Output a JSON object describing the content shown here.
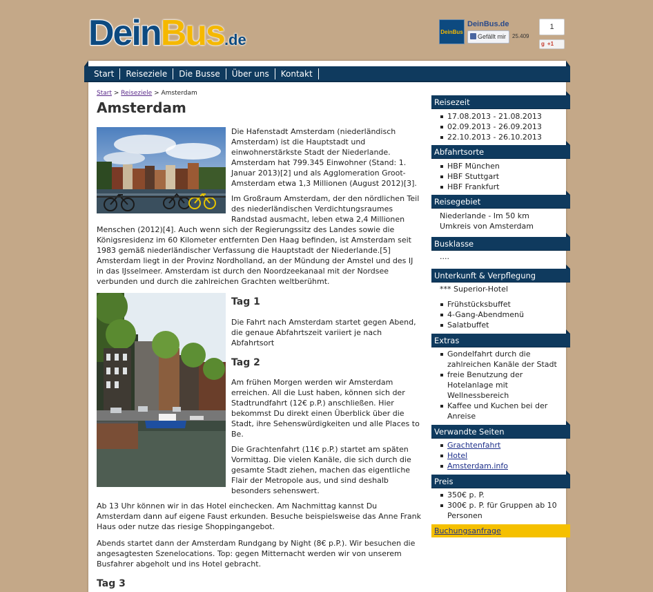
{
  "header": {
    "logo_part1": "Dein",
    "logo_part2": "Bus",
    "logo_part3": ".de",
    "fb_thumb_text": "DeinBus",
    "fb_page_name": "DeinBus.de",
    "fb_like_label": "Gefällt mir",
    "fb_like_count": "25.409",
    "gplus_count": "1",
    "gplus_label": "+1"
  },
  "nav": {
    "items": [
      "Start",
      "Reiseziele",
      "Die Busse",
      "Über uns",
      "Kontakt"
    ]
  },
  "breadcrumb": {
    "start": "Start",
    "sep": ">",
    "reiseziele": "Reiseziele",
    "current": "Amsterdam"
  },
  "page_title": "Amsterdam",
  "content": {
    "intro_p1": "Die Hafenstadt Amsterdam (niederländisch Amsterdam) ist die Hauptstadt und einwohnerstärkste Stadt der Niederlande. Amsterdam hat 799.345 Einwohner (Stand: 1. Januar 2013)[2] und als Agglomeration Groot-Amsterdam etwa 1,3 Millionen (August 2012)[3].",
    "intro_p2a": "Im Großraum Amsterdam, der den nördlichen Teil des niederländischen Verdichtungsraumes Randstad ausmacht, leben etwa 2,4 Millionen",
    "intro_p2b": "Menschen (2012)[4]. Auch wenn sich der Regierungssitz des Landes sowie die Königsresidenz im 60 Kilometer entfernten Den Haag befinden, ist Amsterdam seit 1983 gemäß niederländischer Verfassung die Hauptstadt der Niederlande.[5] Amsterdam liegt in der Provinz Nordholland, an der Mündung der Amstel und des IJ in das IJsselmeer. Amsterdam ist durch den Noordzeekanaal mit der Nordsee verbunden und durch die zahlreichen Grachten weltberühmt.",
    "day1_head": "Tag 1",
    "day1_text": "Die Fahrt nach Amsterdam startet gegen Abend, die genaue Abfahrtszeit variiert je nach Abfahrtsort",
    "day2_head": "Tag 2",
    "day2_p1": "Am frühen Morgen werden wir Amsterdam erreichen. All die Lust haben, können sich der Stadtrundfahrt (12€ p.P.) anschließen. Hier bekommst Du direkt einen Überblick über die Stadt, ihre Sehenswürdigkeiten und alle Places to Be.",
    "day2_p2": "Die Grachtenfahrt (11€ p.P.) startet am späten Vormittag. Die vielen Kanäle, die sich durch die gesamte Stadt ziehen, machen das eigentliche Flair der Metropole aus, und sind deshalb besonders sehenswert.",
    "day2_p3": "Ab 13 Uhr können wir in das Hotel einchecken. Am Nachmittag kannst Du Amsterdam dann auf eigene Faust erkunden. Besuche beispielsweise das Anne Frank Haus oder nutze das riesige Shoppingangebot.",
    "day2_p4": "Abends startet dann der Amsterdam Rundgang by Night (8€ p.P.). Wir besuchen die angesagtesten Szenelocations. Top: gegen Mitternacht werden wir von unserem Busfahrer abgeholt und ins Hotel gebracht.",
    "day3_head": "Tag 3"
  },
  "sidebar": {
    "reisezeit": {
      "title": "Reisezeit",
      "items": [
        "17.08.2013 - 21.08.2013",
        "02.09.2013 - 26.09.2013",
        "22.10.2013 - 26.10.2013"
      ]
    },
    "abfahrtsorte": {
      "title": "Abfahrtsorte",
      "items": [
        "HBF München",
        "HBF Stuttgart",
        "HBF Frankfurt"
      ]
    },
    "reisegebiet": {
      "title": "Reisegebiet",
      "text": "Niederlande - Im 50 km Umkreis von Amsterdam"
    },
    "busklasse": {
      "title": "Busklasse",
      "text": "...."
    },
    "unterkunft": {
      "title": "Unterkunft & Verpflegung",
      "stars": "***",
      "hotel": "Superior-Hotel",
      "items": [
        "Frühstücksbuffet",
        "4-Gang-Abendmenü",
        "Salatbuffet"
      ]
    },
    "extras": {
      "title": "Extras",
      "items": [
        "Gondelfahrt durch die zahlreichen Kanäle der Stadt",
        "freie Benutzung der Hotelanlage mit Wellnessbereich",
        "Kaffee und Kuchen bei der Anreise"
      ]
    },
    "verwandte": {
      "title": "Verwandte Seiten",
      "items": [
        "Grachtenfahrt",
        "Hotel",
        "Amsterdam.info"
      ]
    },
    "preis": {
      "title": "Preis",
      "items": [
        "350€ p. P.",
        "300€ p. P. für Gruppen ab 10 Personen"
      ]
    },
    "booking_label": "Buchungsanfrage"
  },
  "colors": {
    "background": "#c4a888",
    "nav_blue": "#0f3a5e",
    "logo_blue": "#0d4a80",
    "logo_yellow": "#f5b800",
    "booking_yellow": "#f5c000"
  }
}
